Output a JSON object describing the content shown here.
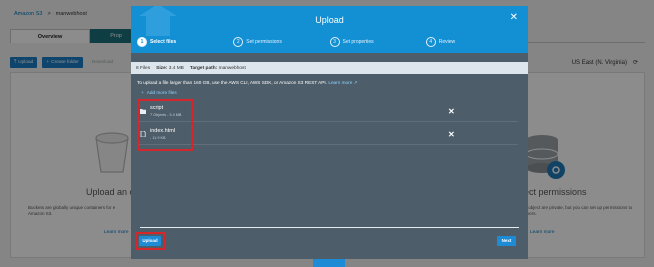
{
  "breadcrumb": {
    "root": "Amazon S3",
    "separator": ">",
    "current": "manwebhost"
  },
  "tabs": {
    "overview": "Overview",
    "properties": "Prop"
  },
  "toolbar": {
    "upload": "Upload",
    "create_folder": "Create folder",
    "download": "Download"
  },
  "region": {
    "label": "US East (N. Virginia)"
  },
  "background": {
    "left_heading": "Upload an o",
    "left_desc": "Buckets are globally unique containers for e Amazon S3.",
    "left_link": "Learn more",
    "right_heading": "ect permissions",
    "right_desc": "er object are private, but you can set up permissions to others.",
    "right_link": "Learn more"
  },
  "modal": {
    "title": "Upload",
    "steps": [
      {
        "num": "1",
        "label": "Select files"
      },
      {
        "num": "2",
        "label": "Set permissions"
      },
      {
        "num": "3",
        "label": "Set properties"
      },
      {
        "num": "4",
        "label": "Review"
      }
    ],
    "summary": {
      "files": "8 Files",
      "size_label": "Size:",
      "size_value": "3.4 MB",
      "target_label": "Target path:",
      "target_value": "manwebhost"
    },
    "note_text": "To upload a file larger than 160 GB, use the AWS CLI, AWS SDK, or Amazon S3 REST API.",
    "note_link": "Learn more",
    "add_more": "Add more files",
    "files": [
      {
        "name": "script",
        "meta": "7 Objects - 3.4 MB"
      },
      {
        "name": "index.html",
        "meta": "- 11.9 KB"
      }
    ],
    "upload_button": "Upload",
    "next_button": "Next"
  },
  "colors": {
    "modal_header": "#138fd4",
    "modal_body": "#4d5d69",
    "highlight": "#d4262b",
    "primary_button": "#1d8bd6"
  },
  "icons": [
    "close-icon",
    "folder-icon",
    "file-icon",
    "remove-icon",
    "plus-icon",
    "refresh-icon",
    "external-link-icon"
  ]
}
